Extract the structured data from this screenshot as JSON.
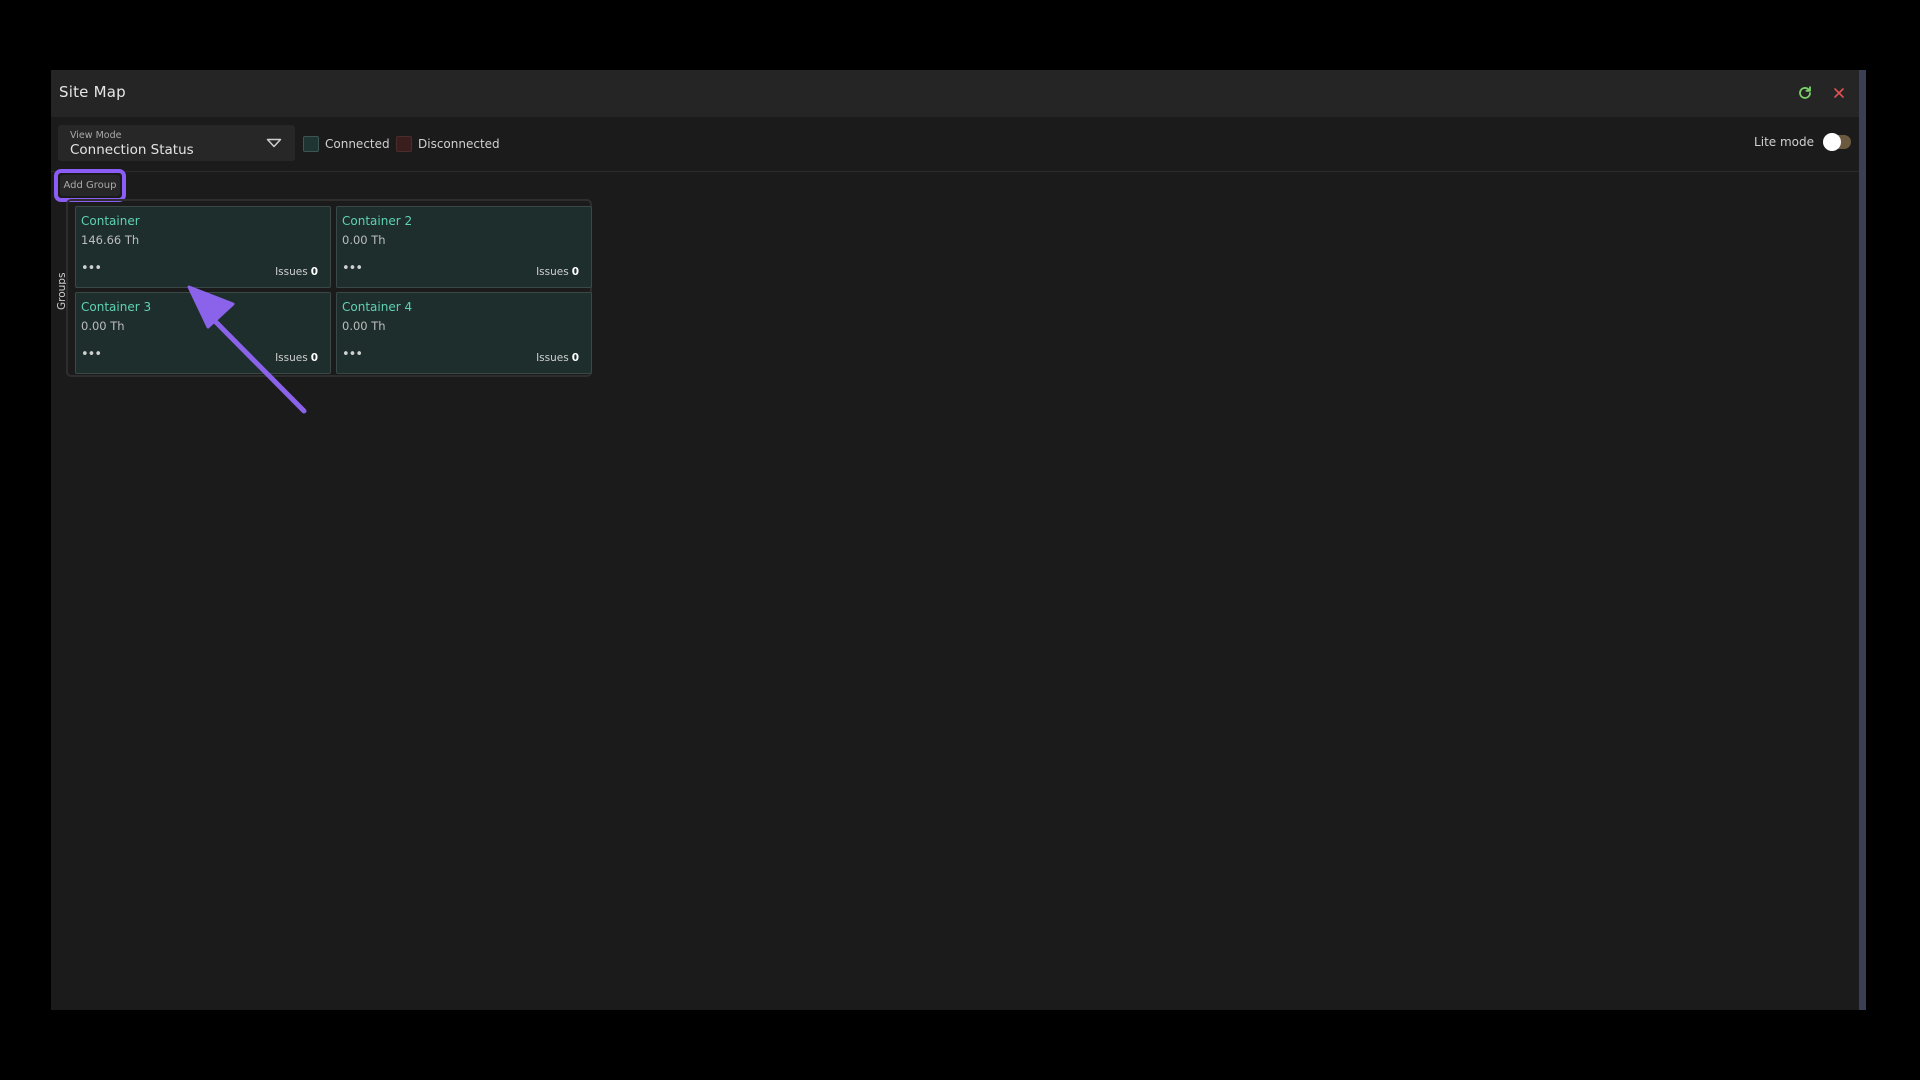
{
  "window": {
    "title": "Site Map"
  },
  "toolbar": {
    "view_mode_label": "View Mode",
    "view_mode_value": "Connection Status",
    "legend": [
      {
        "label": "Connected",
        "color": "#1f3533"
      },
      {
        "label": "Disconnected",
        "color": "#3a1e1e"
      }
    ],
    "lite_mode_label": "Lite mode",
    "lite_mode_on": false
  },
  "actions": {
    "add_group_label": "Add Group"
  },
  "groups": {
    "label": "Groups",
    "containers": [
      {
        "name": "Container",
        "rate": "146.66 Th",
        "issues_label": "Issues",
        "issues": "0"
      },
      {
        "name": "Container 2",
        "rate": "0.00 Th",
        "issues_label": "Issues",
        "issues": "0"
      },
      {
        "name": "Container 3",
        "rate": "0.00 Th",
        "issues_label": "Issues",
        "issues": "0"
      },
      {
        "name": "Container 4",
        "rate": "0.00 Th",
        "issues_label": "Issues",
        "issues": "0"
      }
    ]
  },
  "colors": {
    "accent_text": "#5fd2b3",
    "highlight": "#8b5cf6",
    "refresh_icon": "#7bd36a",
    "close_icon": "#e05252"
  },
  "icons": [
    "refresh-icon",
    "close-icon",
    "chevron-down-icon",
    "more-icon",
    "pointer-arrow"
  ]
}
